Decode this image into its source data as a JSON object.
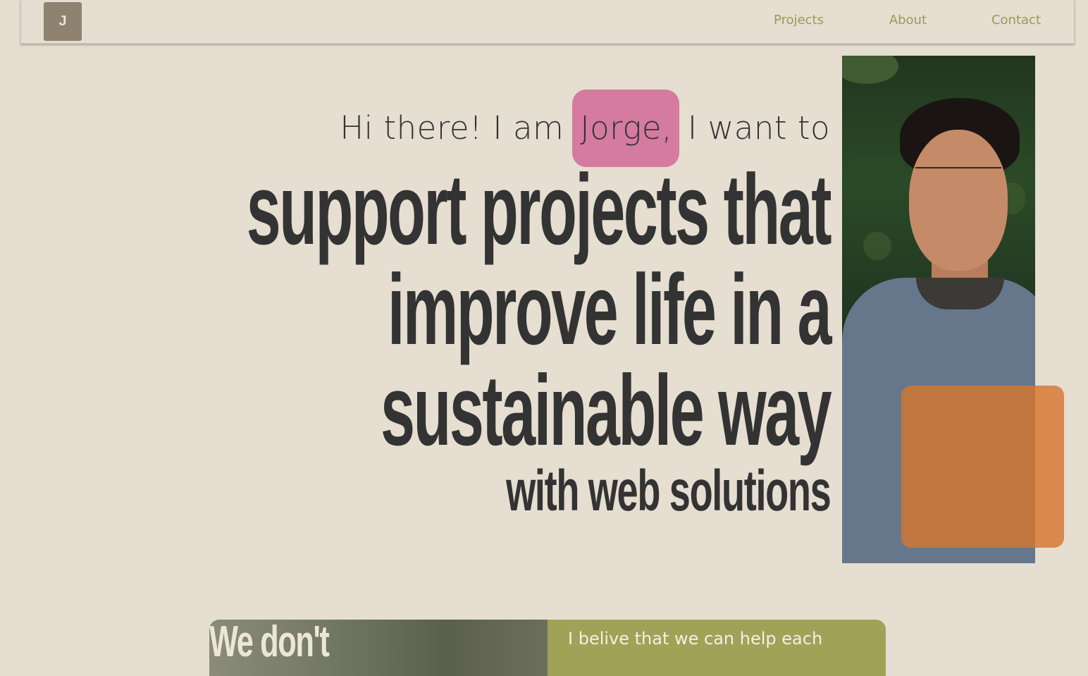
{
  "nav": {
    "logo_letter": "J",
    "links": [
      "Projects",
      "About",
      "Contact"
    ]
  },
  "hero": {
    "intro_before": "Hi there! I am",
    "name": "Jorge,",
    "intro_after": "I want to",
    "headline_lines": [
      "support projects that",
      "improve life in a",
      "sustainable way"
    ],
    "subheadline": "with web solutions"
  },
  "bottom": {
    "photo_heading": "We don't",
    "panel_text": "I belive that we can help each"
  },
  "colors": {
    "background": "#e5ded1",
    "text": "#333333",
    "nav_link": "#9b9a56",
    "logo_bg": "#8e8271",
    "name_highlight": "#d57b9f",
    "orange_box": "#d67630",
    "panel_green": "#a1a257"
  }
}
